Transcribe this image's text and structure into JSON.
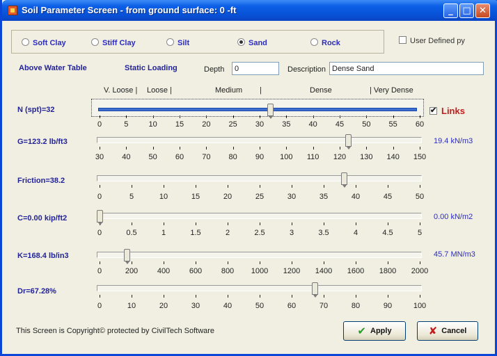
{
  "window": {
    "title": "Soil Parameter Screen - from ground surface: 0 -ft",
    "minimize": "_",
    "maximize": "□",
    "close": "✕"
  },
  "soil_types": [
    {
      "label": "Soft Clay",
      "selected": false
    },
    {
      "label": "Stiff Clay",
      "selected": false
    },
    {
      "label": "Silt",
      "selected": false
    },
    {
      "label": "Sand",
      "selected": true
    },
    {
      "label": "Rock",
      "selected": false
    }
  ],
  "user_defined": {
    "label": "User Defined py",
    "checked": false
  },
  "info": {
    "water_table": "Above Water Table",
    "loading": "Static Loading",
    "depth_label": "Depth",
    "depth_value": "0",
    "description_label": "Description",
    "description_value": "Dense Sand"
  },
  "density_scale": {
    "very_loose": "V. Loose",
    "loose": "Loose",
    "medium": "Medium",
    "dense": "Dense",
    "very_dense": "Very Dense"
  },
  "sliders": [
    {
      "id": "n",
      "label": "N (spt)=32",
      "ticks": [
        "0",
        "5",
        "10",
        "15",
        "20",
        "25",
        "30",
        "35",
        "40",
        "45",
        "50",
        "55",
        "60"
      ],
      "min": 0,
      "max": 60,
      "value": 32,
      "unit": ""
    },
    {
      "id": "g",
      "label": "G=123.2 lb/ft3",
      "ticks": [
        "30",
        "40",
        "50",
        "60",
        "70",
        "80",
        "90",
        "100",
        "110",
        "120",
        "130",
        "140",
        "150"
      ],
      "min": 30,
      "max": 150,
      "value": 123.2,
      "unit": "19.4 kN/m3"
    },
    {
      "id": "friction",
      "label": "Friction=38.2",
      "ticks": [
        "0",
        "5",
        "10",
        "15",
        "20",
        "25",
        "30",
        "35",
        "40",
        "45",
        "50"
      ],
      "min": 0,
      "max": 50,
      "value": 38.2,
      "unit": ""
    },
    {
      "id": "c",
      "label": "C=0.00 kip/ft2",
      "ticks": [
        "0",
        "0.5",
        "1",
        "1.5",
        "2",
        "2.5",
        "3",
        "3.5",
        "4",
        "4.5",
        "5"
      ],
      "min": 0,
      "max": 5,
      "value": 0,
      "unit": "0.00 kN/m2"
    },
    {
      "id": "k",
      "label": "K=168.4 lb/in3",
      "ticks": [
        "0",
        "200",
        "400",
        "600",
        "800",
        "1000",
        "1200",
        "1400",
        "1600",
        "1800",
        "2000"
      ],
      "min": 0,
      "max": 2000,
      "value": 168.4,
      "unit": "45.7 MN/m3"
    },
    {
      "id": "dr",
      "label": "Dr=67.28%",
      "ticks": [
        "0",
        "10",
        "20",
        "30",
        "40",
        "50",
        "60",
        "70",
        "80",
        "90",
        "100"
      ],
      "min": 0,
      "max": 100,
      "value": 67.28,
      "unit": ""
    }
  ],
  "links": {
    "label": "Links",
    "checked": true
  },
  "footer": "This Screen is Copyright© protected by CivilTech Software",
  "buttons": {
    "apply": "Apply",
    "cancel": "Cancel"
  }
}
